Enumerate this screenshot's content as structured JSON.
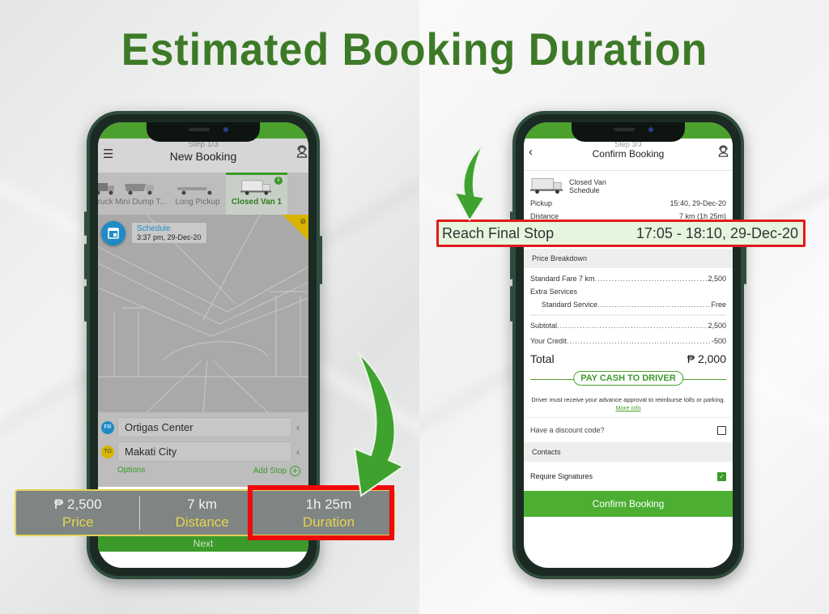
{
  "headline": "Estimated Booking Duration",
  "left_phone": {
    "header": {
      "step": "Step 1/3",
      "title": "New Booking",
      "menu_icon": "hamburger-icon",
      "support_icon": "support-agent-icon"
    },
    "vehicles": [
      {
        "label": "Truck",
        "active": false
      },
      {
        "label": "Mini Dump T...",
        "active": false
      },
      {
        "label": "Long Pickup",
        "active": false
      },
      {
        "label": "Closed Van 1",
        "active": true
      }
    ],
    "info_badge": "i",
    "schedule": {
      "title": "Schedule",
      "time": "3:37 pm, 29-Dec-20",
      "icon": "calendar-icon"
    },
    "traffic_icon": "traffic-icon",
    "route": {
      "from_badge": "FR",
      "from": "Ortigas Center",
      "to_badge": "TO",
      "to": "Makati City",
      "options_label": "Options",
      "add_stop_label": "Add Stop"
    },
    "next_label": "Next"
  },
  "stats": [
    {
      "value": "₱ 2,500",
      "key": "Price"
    },
    {
      "value": "7 km",
      "key": "Distance"
    },
    {
      "value": "1h 25m",
      "key": "Duration",
      "highlighted": true
    }
  ],
  "right_phone": {
    "header": {
      "step": "Step 3/3",
      "title": "Confirm Booking",
      "back_icon": "chevron-left-icon",
      "support_icon": "support-agent-icon"
    },
    "vehicle": {
      "name": "Closed Van",
      "type": "Schedule"
    },
    "pickup": {
      "label": "Pickup",
      "value": "15:40, 29-Dec-20"
    },
    "distance": {
      "label": "Distance",
      "value": "7 km (1h 25m)"
    },
    "price_breakdown": {
      "title": "Price Breakdown",
      "rows": [
        {
          "label": "Standard Fare 7 km",
          "value": "2,500"
        }
      ],
      "extra_services_label": "Extra Services",
      "extra_rows": [
        {
          "label": "Standard Service",
          "value": "Free"
        }
      ],
      "subtotal": {
        "label": "Subtotal",
        "value": "2,500"
      },
      "credit": {
        "label": "Your Credit",
        "value": "-500"
      },
      "total": {
        "label": "Total",
        "value": "₱ 2,000"
      }
    },
    "payment_method": "PAY CASH TO DRIVER",
    "driver_note": "Driver must receive your advance approval to reimburse tolls or parking.",
    "more_info_link": "More info",
    "discount": {
      "label": "Have a discount code?",
      "checked": false
    },
    "contacts_title": "Contacts",
    "require_signatures": {
      "label": "Require Signatures",
      "checked": true
    },
    "confirm_label": "Confirm Booking"
  },
  "reach_final_stop": {
    "label": "Reach Final Stop",
    "value": "17:05 - 18:10, 29-Dec-20"
  },
  "colors": {
    "brand_green": "#4ca12e",
    "headline_green": "#3d7a27",
    "highlight_red": "#e11b1b",
    "stat_yellow": "#e8d44d"
  }
}
